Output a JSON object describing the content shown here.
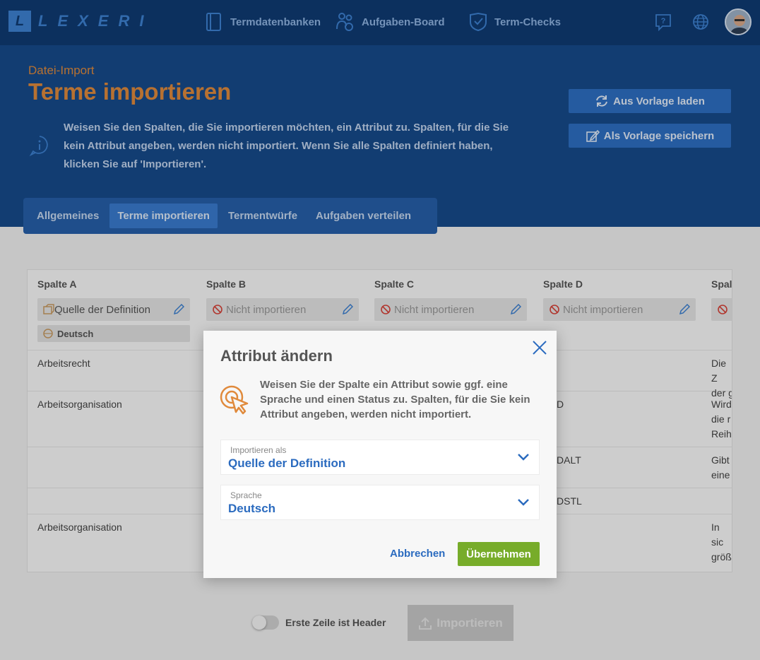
{
  "app": {
    "logo_mark": "L",
    "logo_text": "LEXERI"
  },
  "nav": {
    "items": [
      {
        "label": "Termdatenbanken",
        "icon": "book-icon"
      },
      {
        "label": "Aufgaben-Board",
        "icon": "people-icon"
      },
      {
        "label": "Term-Checks",
        "icon": "shield-check-icon"
      }
    ],
    "right_icons": [
      "help-icon",
      "globe-icon"
    ]
  },
  "header": {
    "kicker": "Datei-Import",
    "title": "Terme importieren",
    "intro": "Weisen Sie den Spalten, die Sie importieren möchten, ein Attribut zu. Spalten, für die Sie kein Attribut angeben, werden nicht importiert. Wenn Sie alle Spalten definiert haben, klicken Sie auf 'Importieren'.",
    "load_template": "Aus Vorlage laden",
    "save_template": "Als Vorlage speichern"
  },
  "tabs": [
    {
      "label": "Allgemeines",
      "active": false
    },
    {
      "label": "Terme importieren",
      "active": true
    },
    {
      "label": "Termentwürfe",
      "active": false
    },
    {
      "label": "Aufgaben verteilen",
      "active": false
    }
  ],
  "table": {
    "columns": [
      {
        "head": "Spalte A",
        "attribute": "Quelle der Definition",
        "language": "Deutsch"
      },
      {
        "head": "Spalte B",
        "attribute": "Nicht importieren"
      },
      {
        "head": "Spalte C",
        "attribute": "Nicht importieren"
      },
      {
        "head": "Spalte D",
        "attribute": "Nicht importieren"
      },
      {
        "head": "Spalt",
        "attribute": "N"
      }
    ],
    "rows": [
      {
        "a": "Arbeitsrecht",
        "d": "",
        "e": "Die Z der g"
      },
      {
        "a": "Arbeitsorganisation",
        "d": "D",
        "e": "Wird die r Reih"
      },
      {
        "a": "",
        "d": "DALT",
        "e": "Gibt eine"
      },
      {
        "a": "",
        "d": "DSTL",
        "e": ""
      },
      {
        "a": "Arbeitsorganisation",
        "d": "",
        "e": "In sic größ"
      }
    ]
  },
  "footer": {
    "toggle_label": "Erste Zeile ist Header",
    "import_label": "Importieren"
  },
  "modal": {
    "title": "Attribut ändern",
    "text": "Weisen Sie der Spalte ein Attribut sowie ggf. eine Sprache und einen Status zu. Spalten, für die Sie kein Attribut angeben, werden nicht importiert.",
    "import_as_label": "Importieren als",
    "import_as_value": "Quelle der Definition",
    "language_label": "Sprache",
    "language_value": "Deutsch",
    "cancel": "Abbrechen",
    "apply": "Übernehmen"
  },
  "colors": {
    "nav_bg": "#0f3b73",
    "hero_bg": "#164b8c",
    "accent_orange": "#e08a3c",
    "primary_blue": "#2b6bbf",
    "apply_green": "#77ac2a"
  }
}
